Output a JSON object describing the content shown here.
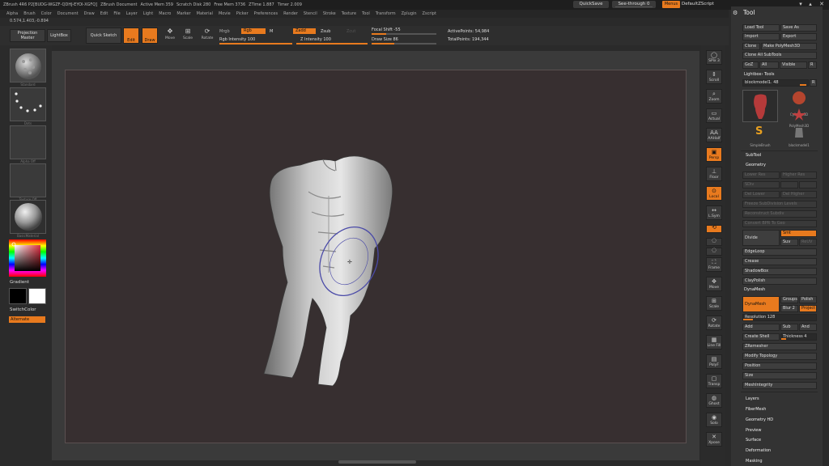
{
  "titlebar": {
    "app": "ZBrush 4R6 P2[BUDG-WGZF-QDHJ-EYOI-XGFQ]",
    "document": "ZBrush Document",
    "active_mem": "Active Mem 359",
    "scratch": "Scratch Disk 280",
    "free_mem": "Free Mem 3736",
    "ztime": "ZTime 1.887",
    "timer": "Timer 2.009",
    "quicksave": "QuickSave",
    "see_through": "See-through 0",
    "menus": "Menus",
    "default_zscript": "DefaultZScript",
    "window_controls": [
      "▾",
      "▴",
      "✕"
    ]
  },
  "menubar": [
    "Alpha",
    "Brush",
    "Color",
    "Document",
    "Draw",
    "Edit",
    "File",
    "Layer",
    "Light",
    "Macro",
    "Marker",
    "Material",
    "Movie",
    "Picker",
    "Preferences",
    "Render",
    "Stencil",
    "Stroke",
    "Texture",
    "Tool",
    "Transform",
    "Zplugin",
    "Zscript"
  ],
  "coords": "0.574,1.403,-0.894",
  "toolbar": {
    "projection_master": "Projection Master",
    "lightbox": "LightBox",
    "quick_sketch": "Quick Sketch",
    "edit": "Edit",
    "draw": "Draw",
    "move": "Move",
    "scale": "Scale",
    "rotate": "Rotate",
    "mrgb": "Mrgb",
    "rgb": "Rgb",
    "m": "M",
    "rgb_intensity": "Rgb Intensity 100",
    "rgb_intensity_value": 1.0,
    "zadd": "Zadd",
    "zsub": "Zsub",
    "zcut": "Zcut",
    "z_intensity": "Z Intensity 100",
    "z_intensity_value": 1.0,
    "focal_shift": "Focal Shift -55",
    "focal_shift_value": -55,
    "draw_size": "Draw Size 86",
    "draw_size_value": 86,
    "active_points": "ActivePoints: 54,984",
    "total_points": "TotalPoints: 194,344"
  },
  "leftshelf": {
    "brush_caption": "Standard",
    "stroke_caption": "Dots",
    "alpha_caption": "Alpha Off",
    "texture_caption": "Texture Off",
    "material_caption": "BasicMaterial",
    "gradient": "Gradient",
    "switch_color": "SwitchColor",
    "alternate": "Alternate"
  },
  "rightshelf": [
    "SPix 3",
    "Scroll",
    "Zoom",
    "Actual",
    "AAHalf",
    "Persp",
    "Floor",
    "Local",
    "L.Sym",
    "Qxyz",
    "",
    "",
    "Frame",
    "Move",
    "Scale",
    "Rotate",
    "Line Fill",
    "PolyF",
    "Transp",
    "Ghost",
    "Solo",
    "Xpose"
  ],
  "tool_panel": {
    "title": "Tool",
    "load_tool": "Load Tool",
    "save_as": "Save As",
    "import": "Import",
    "export": "Export",
    "clone": "Clone",
    "make_polymesh": "Make PolyMesh3D",
    "clone_all": "Clone All SubTools",
    "goz": "GoZ",
    "all": "All",
    "visible": "Visible",
    "r": "R",
    "lightbox_tools": "Lightbox› Tools",
    "blockmodel": "blockmodel1. 48",
    "thumb_names": [
      "",
      "Cylinder3D",
      "",
      "PolyMesh3D",
      "SimpleBrush",
      "blockmodel1"
    ],
    "subtool": "SubTool",
    "geometry": "Geometry",
    "lower_res": "Lower Res",
    "higher_res": "Higher Res",
    "sdiv": "SDiv",
    "del_lower": "Del Lower",
    "del_higher": "Del Higher",
    "freeze_subdivision": "Freeze SubDivision Levels",
    "reconstruct_subdiv": "Reconstruct Subdiv",
    "convert_bpr": "Convert BPR To Geo",
    "divide": "Divide",
    "smt": "Smt",
    "suv": "Suv",
    "reuv": "ReUV",
    "edgeloop": "EdgeLoop",
    "crease": "Crease",
    "shadowbox": "ShadowBox",
    "claypolish": "ClayPolish",
    "dynamesh_section": "DynaMesh",
    "dynamesh_btn": "DynaMesh",
    "groups": "Groups",
    "polish": "Polish",
    "blur": "Blur 2",
    "project": "Project",
    "resolution": "Resolution 128",
    "add": "Add",
    "sub": "Sub",
    "and": "And",
    "create_shell": "Create Shell",
    "thickness": "Thickness 4",
    "zremesher": "ZRemesher",
    "modify_topology": "Modify Topology",
    "position": "Position",
    "size": "Size",
    "meshintegrity": "MeshIntegrity",
    "layers": "Layers",
    "fibermesh": "FiberMesh",
    "geometry_hd": "Geometry HD",
    "preview": "Preview",
    "surface": "Surface",
    "deformation": "Deformation",
    "masking": "Masking"
  },
  "colors": {
    "accent": "#e87a1e",
    "canvas": "#372f30",
    "panel": "#333333"
  }
}
